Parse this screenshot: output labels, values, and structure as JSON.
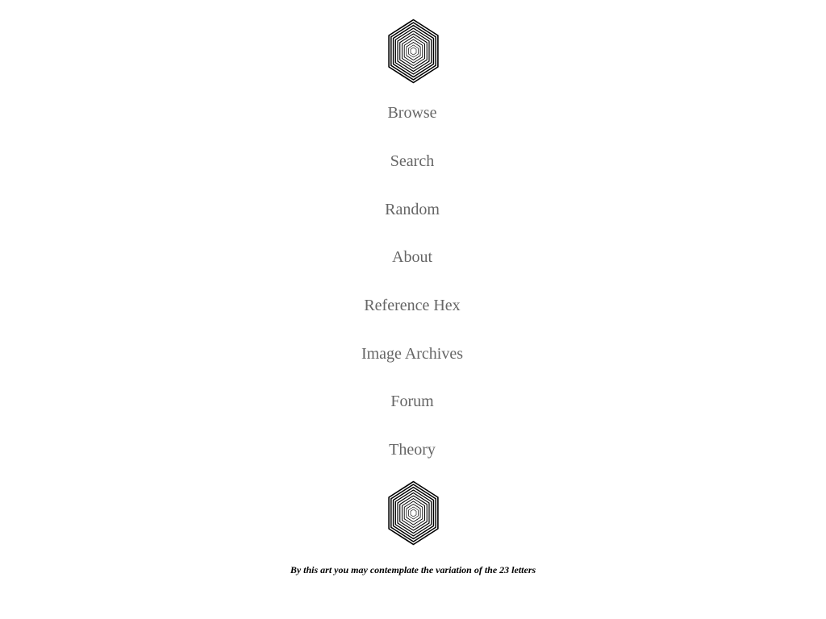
{
  "logo": {
    "icon": "concentric-hexagon-icon",
    "color": "#000000"
  },
  "nav": {
    "items": [
      {
        "label": "Browse"
      },
      {
        "label": "Search"
      },
      {
        "label": "Random"
      },
      {
        "label": "About"
      },
      {
        "label": "Reference Hex"
      },
      {
        "label": "Image Archives"
      },
      {
        "label": "Forum"
      },
      {
        "label": "Theory"
      }
    ],
    "link_color": "#666666"
  },
  "footer": {
    "tagline": "By this art you may contemplate the variation of the 23 letters"
  }
}
